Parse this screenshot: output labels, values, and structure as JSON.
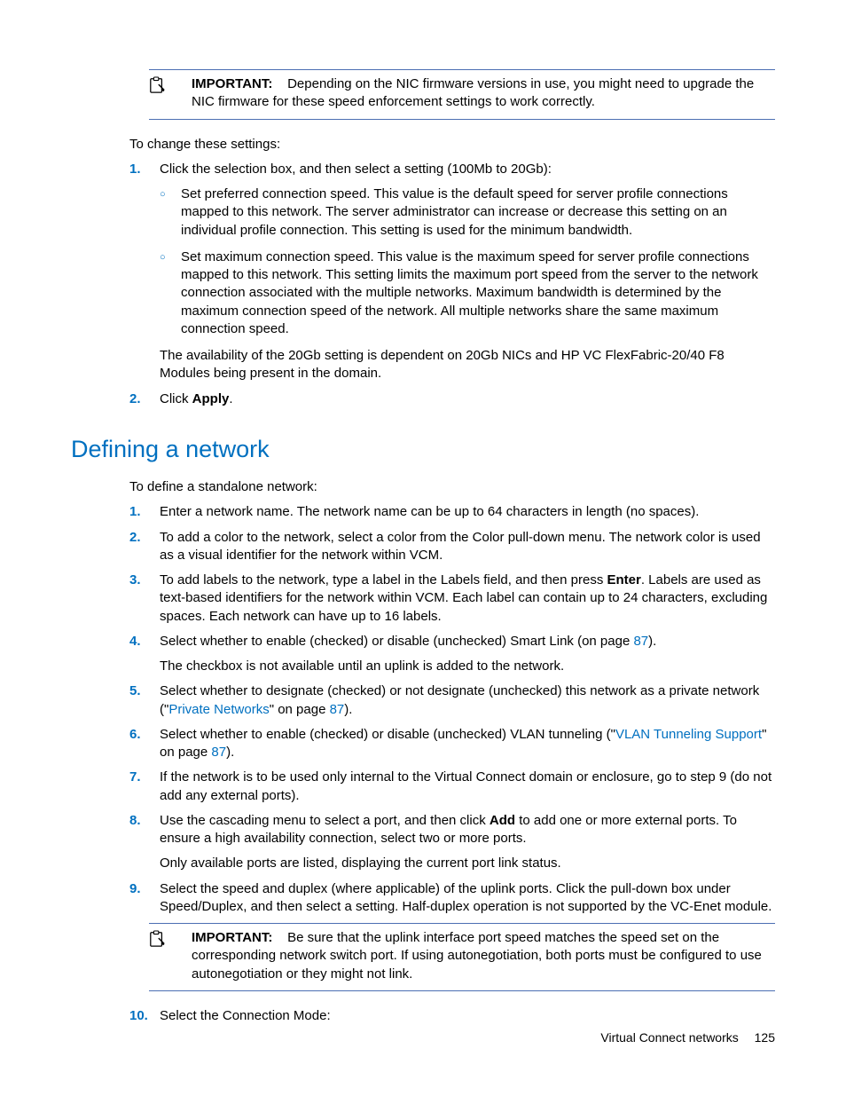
{
  "callout1": {
    "label": "IMPORTANT:",
    "text": "Depending on the NIC firmware versions in use, you might need to upgrade the NIC firmware for these speed enforcement settings to work correctly."
  },
  "intro1": "To change these settings:",
  "list1": {
    "item1": {
      "marker": "1.",
      "lead": "Click the selection box, and then select a setting (100Mb to 20Gb):",
      "sub1": "Set preferred connection speed. This value is the default speed for server profile connections mapped to this network. The server administrator can increase or decrease this setting on an individual profile connection. This setting is used for the minimum bandwidth.",
      "sub2": "Set maximum connection speed. This value is the maximum speed for server profile connections mapped to this network. This setting limits the maximum port speed from the server to the network connection associated with the multiple networks. Maximum bandwidth is determined by the maximum connection speed of the network. All multiple networks share the same maximum connection speed.",
      "tail": "The availability of the 20Gb setting is dependent on 20Gb NICs and HP VC FlexFabric-20/40 F8 Modules being present in the domain."
    },
    "item2": {
      "marker": "2.",
      "pre": "Click ",
      "bold": "Apply",
      "post": "."
    }
  },
  "heading": "Defining a network",
  "intro2": "To define a standalone network:",
  "list2": {
    "i1": {
      "marker": "1.",
      "text": "Enter a network name. The network name can be up to 64 characters in length (no spaces)."
    },
    "i2": {
      "marker": "2.",
      "text": "To add a color to the network, select a color from the Color pull-down menu. The network color is used as a visual identifier for the network within VCM."
    },
    "i3": {
      "marker": "3.",
      "pre": "To add labels to the network, type a label in the Labels field, and then press ",
      "bold": "Enter",
      "post": ". Labels are used as text-based identifiers for the network within VCM. Each label can contain up to 24 characters, excluding spaces. Each network can have up to 16 labels."
    },
    "i4": {
      "marker": "4.",
      "line1_pre": "Select whether to enable (checked) or disable (unchecked) Smart Link (on page ",
      "line1_link": "87",
      "line1_post": ").",
      "line2": "The checkbox is not available until an uplink is added to the network."
    },
    "i5": {
      "marker": "5.",
      "pre": "Select whether to designate (checked) or not designate (unchecked) this network as a private network (\"",
      "link": "Private Networks",
      "mid": "\" on page ",
      "page": "87",
      "post": ")."
    },
    "i6": {
      "marker": "6.",
      "pre": "Select whether to enable (checked) or disable (unchecked) VLAN tunneling (\"",
      "link": "VLAN Tunneling Support",
      "mid": "\" on page ",
      "page": "87",
      "post": ")."
    },
    "i7": {
      "marker": "7.",
      "text": "If the network is to be used only internal to the Virtual Connect domain or enclosure, go to step 9 (do not add any external ports)."
    },
    "i8": {
      "marker": "8.",
      "line1_pre": "Use the cascading menu to select a port, and then click ",
      "line1_bold": "Add",
      "line1_post": " to add one or more external ports. To ensure a high availability connection, select two or more ports.",
      "line2": "Only available ports are listed, displaying the current port link status."
    },
    "i9": {
      "marker": "9.",
      "text": "Select the speed and duplex (where applicable) of the uplink ports. Click the pull-down box under Speed/Duplex, and then select a setting. Half-duplex operation is not supported by the VC-Enet module."
    },
    "i10": {
      "marker": "10.",
      "text": "Select the Connection Mode:"
    }
  },
  "callout2": {
    "label": "IMPORTANT:",
    "text": "Be sure that the uplink interface port speed matches the speed set on the corresponding network switch port. If using autonegotiation, both ports must be configured to use autonegotiation or they might not link."
  },
  "footer": {
    "section": "Virtual Connect networks",
    "page": "125"
  }
}
